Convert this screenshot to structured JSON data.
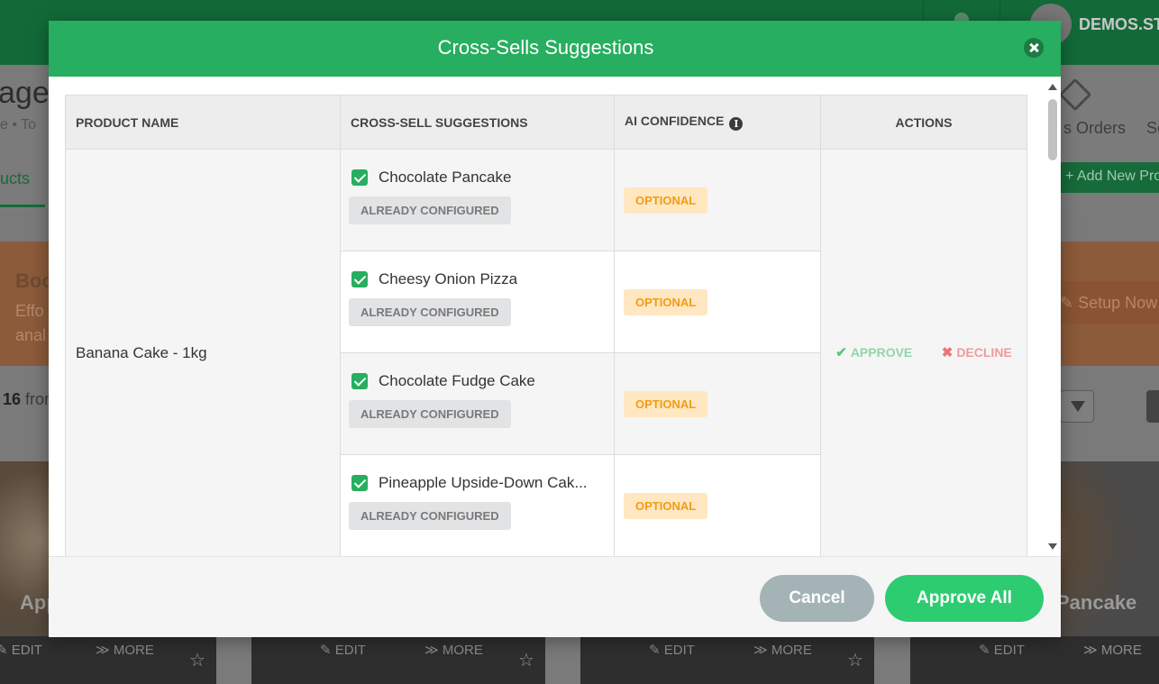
{
  "background": {
    "username": "DEMOS.ST",
    "page_title": "age",
    "breadcrumb": "e  •  To",
    "active_tab": "ucts",
    "orders_label": "s Orders",
    "settings_label": "Se",
    "add_new_label": "+ Add New Pro",
    "banner": {
      "title": "Boo",
      "line1": "Effo",
      "line2": "anal",
      "setup_label": "✎ Setup Now"
    },
    "count_number": "16",
    "count_suffix": " from",
    "cards": [
      {
        "name": "App",
        "edit": "✎ EDIT",
        "more": "≫ MORE"
      },
      {
        "name": "",
        "edit": "✎ EDIT",
        "more": "≫ MORE"
      },
      {
        "name": "",
        "edit": "✎ EDIT",
        "more": "≫ MORE"
      },
      {
        "name": "Pancake",
        "edit": "✎ EDIT",
        "more": "≫ MORE"
      }
    ]
  },
  "modal": {
    "title": "Cross-Sells Suggestions",
    "columns": {
      "product_name": "PRODUCT NAME",
      "suggestions": "CROSS-SELL SUGGESTIONS",
      "confidence": "AI CONFIDENCE",
      "actions": "ACTIONS"
    },
    "product": "Banana Cake - 1kg",
    "suggestions": [
      {
        "name": "Chocolate Pancake",
        "status": "ALREADY CONFIGURED",
        "confidence": "OPTIONAL"
      },
      {
        "name": "Cheesy Onion Pizza",
        "status": "ALREADY CONFIGURED",
        "confidence": "OPTIONAL"
      },
      {
        "name": "Chocolate Fudge Cake",
        "status": "ALREADY CONFIGURED",
        "confidence": "OPTIONAL"
      },
      {
        "name": "Pineapple Upside-Down Cak...",
        "status": "ALREADY CONFIGURED",
        "confidence": "OPTIONAL"
      }
    ],
    "actions": {
      "approve": "APPROVE",
      "decline": "DECLINE"
    },
    "footer": {
      "cancel": "Cancel",
      "approve_all": "Approve All"
    }
  },
  "colors": {
    "brand_green": "#27ae60",
    "approve_green": "#2ecc71",
    "optional_orange": "#f39c12",
    "cancel_gray": "#a4b3b6"
  }
}
